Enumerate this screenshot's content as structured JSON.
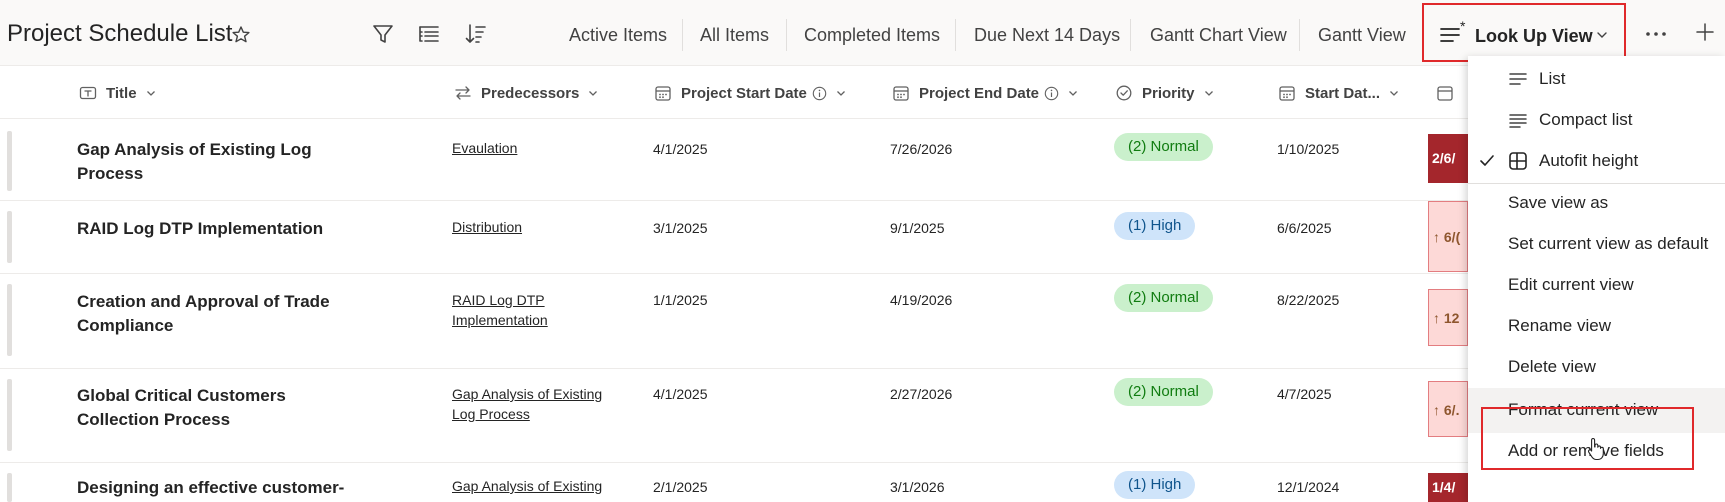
{
  "header": {
    "list_title": "Project Schedule List",
    "views": [
      "Active Items",
      "All Items",
      "Completed Items",
      "Due Next 14 Days",
      "Gantt Chart View",
      "Gantt View"
    ],
    "active_view": "Look Up View"
  },
  "columns": {
    "title": "Title",
    "predecessors": "Predecessors",
    "project_start": "Project Start Date",
    "project_end": "Project End Date",
    "priority": "Priority",
    "start_date": "Start Dat..."
  },
  "rows": [
    {
      "title": "Gap Analysis of Existing Log Process",
      "predecessors": "Evaulation",
      "project_start": "4/1/2025",
      "project_end": "7/26/2026",
      "priority": "(2) Normal",
      "start_date": "1/10/2025",
      "due": "2/6/"
    },
    {
      "title": "RAID Log DTP Implementation",
      "predecessors": "Distribution",
      "project_start": "3/1/2025",
      "project_end": "9/1/2025",
      "priority": "(1) High",
      "start_date": "6/6/2025",
      "due": "↑ 6/("
    },
    {
      "title": "Creation and Approval of Trade Compliance",
      "predecessors": "RAID Log DTP Implementation",
      "project_start": "1/1/2025",
      "project_end": "4/19/2026",
      "priority": "(2) Normal",
      "start_date": "8/22/2025",
      "due": "↑ 12"
    },
    {
      "title": "Global Critical Customers Collection Process",
      "predecessors": "Gap Analysis of Existing Log Process",
      "project_start": "4/1/2025",
      "project_end": "2/27/2026",
      "priority": "(2) Normal",
      "start_date": "4/7/2025",
      "due": "↑ 6/."
    },
    {
      "title": "Designing an effective customer-",
      "predecessors": "Gap Analysis of Existing",
      "project_start": "2/1/2025",
      "project_end": "3/1/2026",
      "priority": "(1) High",
      "start_date": "12/1/2024",
      "due": "1/4/"
    }
  ],
  "menu": {
    "list": "List",
    "compact_list": "Compact list",
    "autofit_height": "Autofit height",
    "save_view_as": "Save view as",
    "set_default": "Set current view as default",
    "edit_view": "Edit current view",
    "rename_view": "Rename view",
    "delete_view": "Delete view",
    "format_view": "Format current view",
    "add_remove_fields": "Add or remove fields"
  },
  "colors": {
    "highlight_border": "#e0292b",
    "pill_normal_bg": "#caf0cc",
    "pill_high_bg": "#cfe4fa",
    "due_dark_bg": "#a4262c",
    "due_light_bg": "#fdd9d7"
  },
  "icons": {
    "favorite": "star-icon",
    "filter": "filter-icon",
    "group": "group-by-icon",
    "sort": "sort-icon",
    "view": "lines-icon",
    "more": "ellipsis-icon",
    "add": "plus-icon"
  }
}
